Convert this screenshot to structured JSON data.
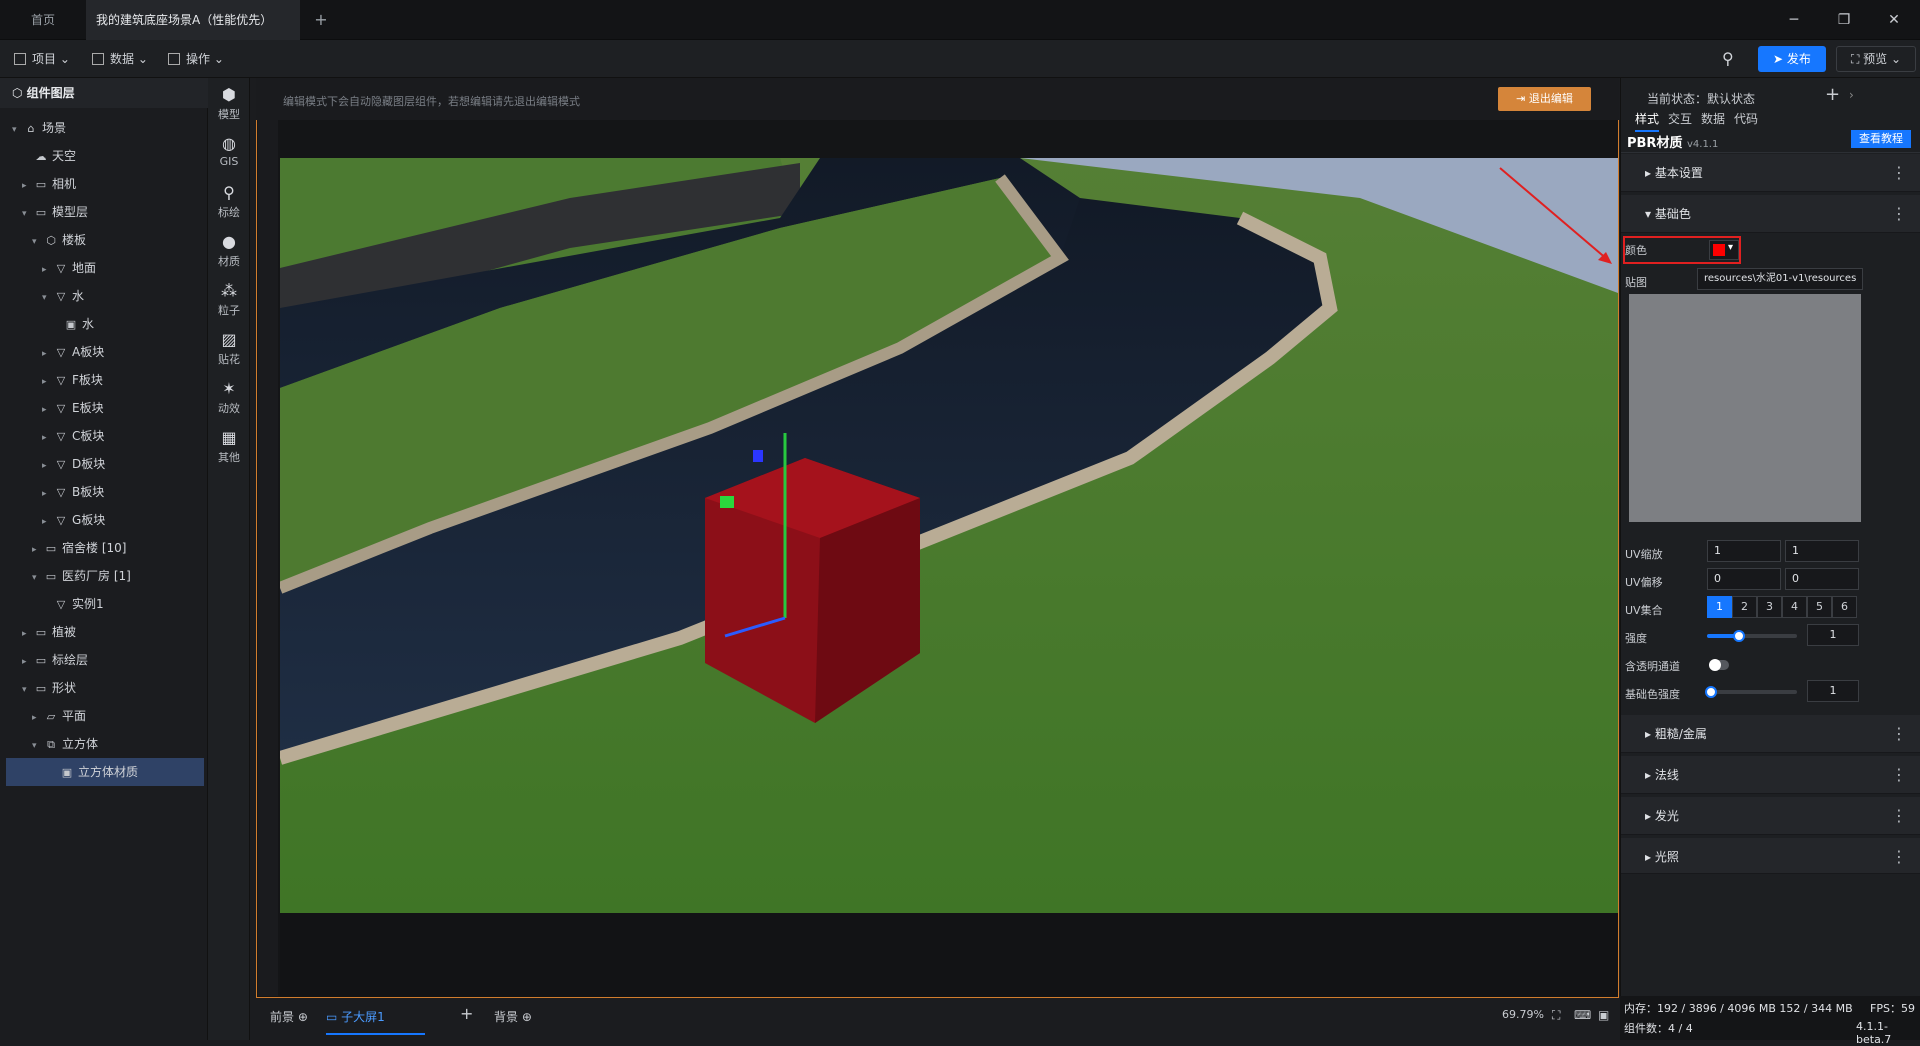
{
  "tabs": {
    "home": "首页",
    "scene": "我的建筑底座场景A（性能优先）",
    "add": "+"
  },
  "window": {
    "minimize": "─",
    "restore": "❐",
    "close": "✕"
  },
  "toolbar": {
    "project": "项目",
    "data": "数据",
    "operation": "操作",
    "publish": "发布",
    "preview": "预览"
  },
  "left": {
    "header": "组件图层",
    "tree": [
      {
        "label": "场景",
        "level": 0,
        "arrow": "▾",
        "icon": "⌂"
      },
      {
        "label": "天空",
        "level": 1,
        "arrow": "",
        "icon": "☁"
      },
      {
        "label": "相机",
        "level": 1,
        "arrow": "▸",
        "icon": "▭"
      },
      {
        "label": "模型层",
        "level": 1,
        "arrow": "▾",
        "icon": "▭"
      },
      {
        "label": "楼板",
        "level": 2,
        "arrow": "▾",
        "icon": "⬡"
      },
      {
        "label": "地面",
        "level": 3,
        "arrow": "▸",
        "icon": "▽"
      },
      {
        "label": "水",
        "level": 3,
        "arrow": "▾",
        "icon": "▽"
      },
      {
        "label": "水",
        "level": 4,
        "arrow": "",
        "icon": "▣"
      },
      {
        "label": "A板块",
        "level": 3,
        "arrow": "▸",
        "icon": "▽"
      },
      {
        "label": "F板块",
        "level": 3,
        "arrow": "▸",
        "icon": "▽"
      },
      {
        "label": "E板块",
        "level": 3,
        "arrow": "▸",
        "icon": "▽"
      },
      {
        "label": "C板块",
        "level": 3,
        "arrow": "▸",
        "icon": "▽"
      },
      {
        "label": "D板块",
        "level": 3,
        "arrow": "▸",
        "icon": "▽"
      },
      {
        "label": "B板块",
        "level": 3,
        "arrow": "▸",
        "icon": "▽"
      },
      {
        "label": "G板块",
        "level": 3,
        "arrow": "▸",
        "icon": "▽"
      },
      {
        "label": "宿舍楼 [10]",
        "level": 2,
        "arrow": "▸",
        "icon": "▭"
      },
      {
        "label": "医药厂房 [1]",
        "level": 2,
        "arrow": "▾",
        "icon": "▭"
      },
      {
        "label": "实例1",
        "level": 3,
        "arrow": "",
        "icon": "▽"
      },
      {
        "label": "植被",
        "level": 1,
        "arrow": "▸",
        "icon": "▭"
      },
      {
        "label": "标绘层",
        "level": 1,
        "arrow": "▸",
        "icon": "▭"
      },
      {
        "label": "形状",
        "level": 1,
        "arrow": "▾",
        "icon": "▭"
      },
      {
        "label": "平面",
        "level": 2,
        "arrow": "▸",
        "icon": "▱"
      },
      {
        "label": "立方体",
        "level": 2,
        "arrow": "▾",
        "icon": "⧉"
      },
      {
        "label": "立方体材质",
        "level": 3,
        "arrow": "",
        "icon": "▣"
      }
    ]
  },
  "iconcol": [
    {
      "label": "模型",
      "icon": "model-icon",
      "glyph": "⬢"
    },
    {
      "label": "GIS",
      "icon": "globe-icon",
      "glyph": "◍"
    },
    {
      "label": "标绘",
      "icon": "pin-icon",
      "glyph": "⚲"
    },
    {
      "label": "材质",
      "icon": "material-icon",
      "glyph": "●"
    },
    {
      "label": "粒子",
      "icon": "particle-icon",
      "glyph": "⁂"
    },
    {
      "label": "贴花",
      "icon": "decal-icon",
      "glyph": "▨"
    },
    {
      "label": "动效",
      "icon": "effect-icon",
      "glyph": "✶"
    },
    {
      "label": "其他",
      "icon": "grid-icon",
      "glyph": "▦"
    }
  ],
  "canvas": {
    "hint": "编辑模式下会自动隐藏图层组件，若想编辑请先退出编辑模式",
    "exit": "退出编辑"
  },
  "bottom": {
    "front": "前景",
    "sub_screen": "子大屏1",
    "add": "+",
    "background": "背景",
    "zoom": "69.79%"
  },
  "right": {
    "state": "当前状态：默认状态",
    "tabs": [
      "样式",
      "交互",
      "数据",
      "代码"
    ],
    "title": "PBR材质",
    "version": "v4.1.1",
    "tutorial": "查看教程",
    "sections": {
      "basic": "基本设置",
      "base_color": "基础色",
      "rough": "粗糙/金属",
      "normal": "法线",
      "emissive": "发光",
      "light": "光照"
    },
    "color_label": "颜色",
    "color_value": "#ff0000",
    "map_label": "贴图",
    "map_value": "resources\\水泥01-v1\\resources",
    "uv_scale_label": "UV缩放",
    "uv_scale": [
      "1",
      "1"
    ],
    "uv_offset_label": "UV偏移",
    "uv_offset": [
      "0",
      "0"
    ],
    "uv_set_label": "UV集合",
    "uv_sets": [
      "1",
      "2",
      "3",
      "4",
      "5",
      "6"
    ],
    "uv_set_selected": 0,
    "intensity_label": "强度",
    "intensity": "1",
    "intensity_level": 0.35,
    "alpha_label": "含透明通道",
    "alpha_on": false,
    "base_intensity_label": "基础色强度",
    "base_intensity": "1",
    "base_intensity_level": 0.0
  },
  "status": {
    "memory": "内存：192 / 3896 / 4096 MB  152 / 344 MB",
    "fps": "FPS：59",
    "components": "组件数：4 / 4",
    "version": "4.1.1-beta.7"
  }
}
